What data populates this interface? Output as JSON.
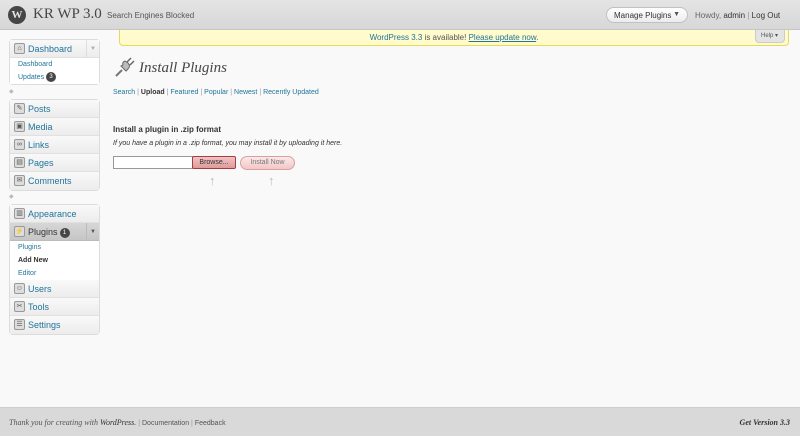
{
  "header": {
    "logo": "W",
    "site_title": "KR WP 3.0",
    "site_status": "Search Engines Blocked",
    "favorite_actions": "Manage Plugins",
    "favorite_arrow": "▼",
    "howdy": "Howdy,",
    "username": "admin",
    "separator": "|",
    "logout": "Log Out"
  },
  "nag": {
    "link1": "WordPress 3.3",
    "text": " is available! ",
    "link2": "Please update now",
    "end": "."
  },
  "help": "Help ▾",
  "menu": {
    "dashboard": "Dashboard",
    "dashboard_sub": "Dashboard",
    "updates": "Updates",
    "updates_count": "3",
    "posts": "Posts",
    "media": "Media",
    "links": "Links",
    "pages": "Pages",
    "comments": "Comments",
    "appearance": "Appearance",
    "plugins": "Plugins",
    "plugins_count": "1",
    "plugins_sub": "Plugins",
    "add_new": "Add New",
    "editor": "Editor",
    "users": "Users",
    "tools": "Tools",
    "settings": "Settings",
    "toggle": "▼"
  },
  "main": {
    "title": "Install Plugins",
    "tabs": [
      "Search",
      "Upload",
      "Featured",
      "Popular",
      "Newest",
      "Recently Updated"
    ],
    "tab_sep": "|",
    "section_title": "Install a plugin in .zip format",
    "section_desc": "If you have a plugin in a .zip format, you may install it by uploading it here.",
    "browse": "Browse...",
    "install": "Install Now",
    "arrow": "↑"
  },
  "footer": {
    "thanks": "Thank you for creating with ",
    "wp": "WordPress",
    "dot": ".",
    "sep": "|",
    "documentation": "Documentation",
    "feedback": "Feedback",
    "version": "Get Version 3.3"
  },
  "colors": {
    "link": "#21759b",
    "nag_bg": "#fffbcc",
    "button_red": "#e09a9a"
  }
}
